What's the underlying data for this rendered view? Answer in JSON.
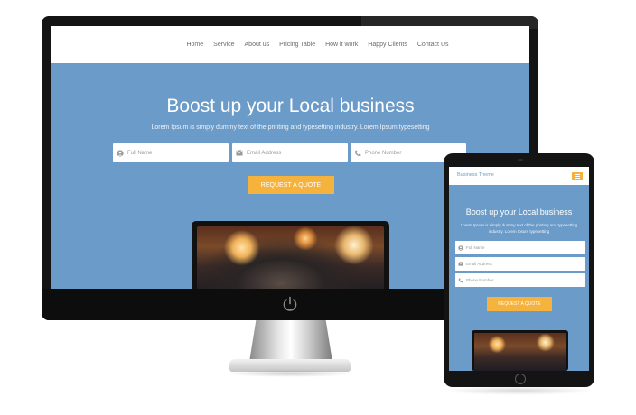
{
  "desktop": {
    "nav": [
      "Home",
      "Service",
      "About us",
      "Pricing Table",
      "How it work",
      "Happy Clients",
      "Contact Us"
    ],
    "hero_title": "Boost up your Local business",
    "hero_subtitle": "Lorem Ipsum is simply dummy text of the printing and typesetting industry. Lorem Ipsum typesetting",
    "fields": [
      {
        "placeholder": "Full Name",
        "icon": "user-icon"
      },
      {
        "placeholder": "Email Address",
        "icon": "envelope-icon"
      },
      {
        "placeholder": "Phone Number",
        "icon": "phone-icon"
      }
    ],
    "cta_label": "REQUEST A QUOTE"
  },
  "mobile": {
    "brand": "Business Theme",
    "menu_icon": "hamburger-menu-icon",
    "hero_title": "Boost up your Local business",
    "hero_subtitle": "Lorem Ipsum is simply dummy text of the printing and typesetting industry. Lorem Ipsum typesetting",
    "fields": [
      {
        "placeholder": "Full Name",
        "icon": "user-icon"
      },
      {
        "placeholder": "Email Address",
        "icon": "envelope-icon"
      },
      {
        "placeholder": "Phone Number",
        "icon": "phone-icon"
      }
    ],
    "cta_label": "REQUEST A QUOTE"
  },
  "colors": {
    "hero_bg": "#6b9bc9",
    "accent": "#f5b23d",
    "device_frame": "#141414"
  }
}
